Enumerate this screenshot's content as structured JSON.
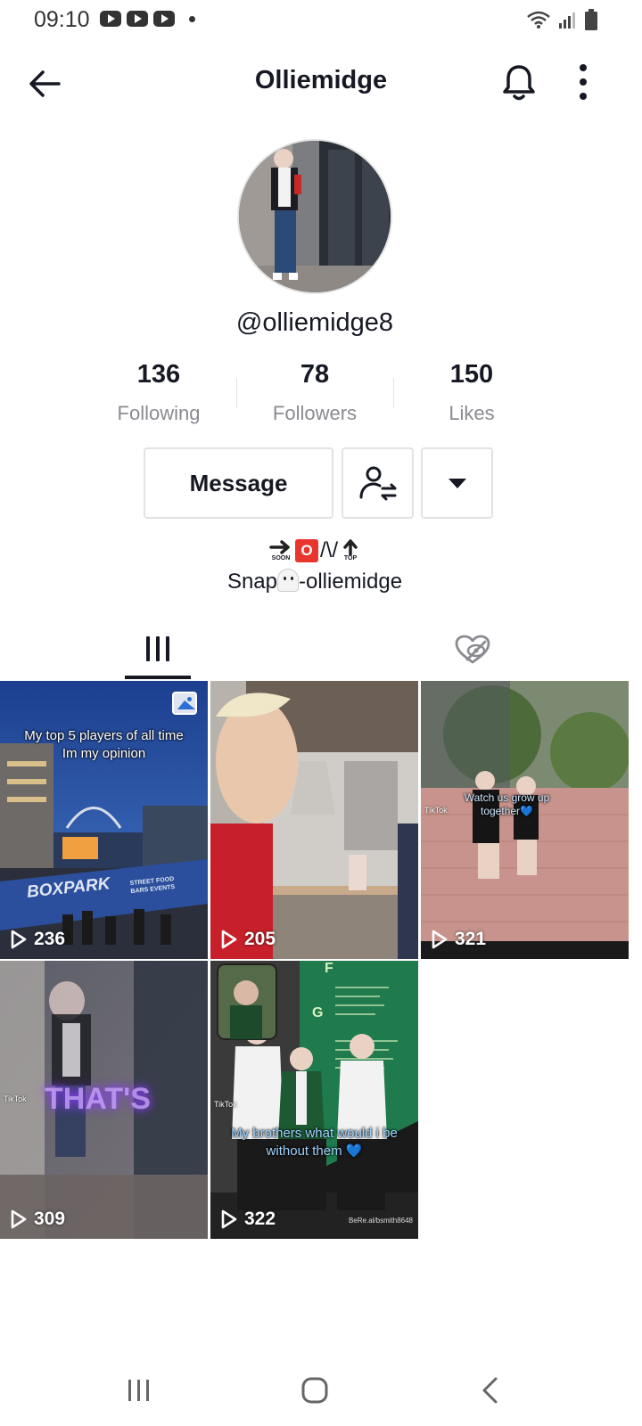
{
  "status_bar": {
    "time": "09:10",
    "app_icons": [
      "youtube-icon",
      "youtube-icon",
      "youtube-icon",
      "notification-dot-icon"
    ],
    "right_icons": [
      "wifi-icon",
      "signal-icon",
      "battery-icon"
    ]
  },
  "header": {
    "title": "Olliemidge",
    "icons": [
      "back-arrow-icon",
      "bell-icon",
      "more-vertical-icon"
    ]
  },
  "profile": {
    "username": "@olliemidge8",
    "stats": [
      {
        "value": "136",
        "label": "Following"
      },
      {
        "value": "78",
        "label": "Followers"
      },
      {
        "value": "150",
        "label": "Likes"
      }
    ],
    "message_button": "Message",
    "bio": {
      "line1_emojis": [
        "soon-arrow-emoji",
        "o-button-emoji",
        "top-arrow-emoji"
      ],
      "line1_text": "/\\/",
      "soon_label": "SOON",
      "top_label": "TOP",
      "o_letter": "O",
      "line2_prefix": "Snap",
      "line2_suffix": "-olliemidge"
    }
  },
  "tabs": [
    {
      "name": "videos",
      "icon": "grid-icon",
      "active": true
    },
    {
      "name": "liked",
      "icon": "hidden-heart-icon",
      "active": false
    }
  ],
  "videos": [
    {
      "views": "236",
      "caption": "My top 5 players of all time\nIm my opinion",
      "sign": "BOXPARK",
      "sign_small": "STREET FOOD\nBARS EVENTS",
      "photo_badge": true
    },
    {
      "views": "205",
      "caption": ""
    },
    {
      "views": "321",
      "caption": "Watch us grow up together💙",
      "tiktok": "TikTok"
    },
    {
      "views": "309",
      "caption": "THAT'S",
      "tiktok": "TikTok"
    },
    {
      "views": "322",
      "caption": "My brothers what would i be without them 💙",
      "tiktok": "TikTok",
      "credit": "BeRe.al/bsmith8648",
      "board_letters": [
        "F",
        "G"
      ]
    }
  ],
  "colors": {
    "text_primary": "#161823",
    "text_secondary": "#8a8b91",
    "border": "#e3e3e4",
    "o_button": "#e8362f"
  }
}
